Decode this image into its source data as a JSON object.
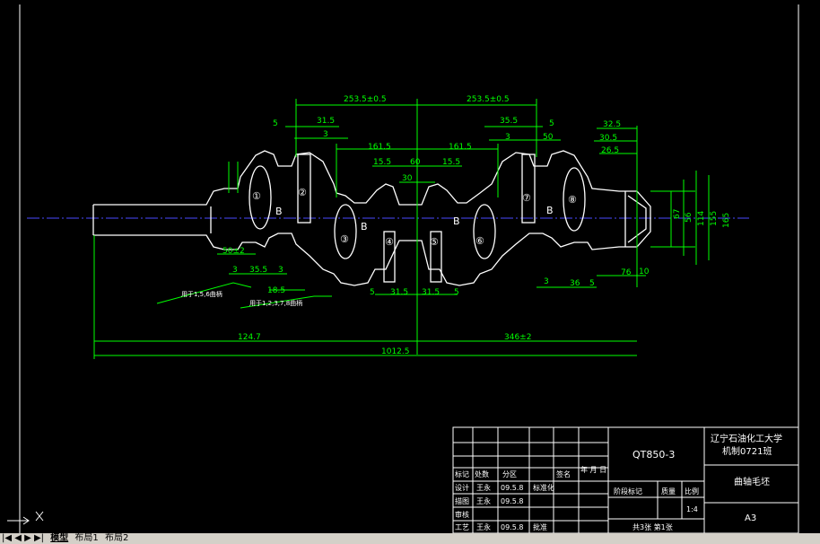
{
  "tabs": {
    "nav": "|◀ ◀ ▶ ▶|",
    "model": "模型",
    "layout1": "布局1",
    "layout2": "布局2"
  },
  "dimensions": {
    "d253_left": "253.5±0.5",
    "d253_right": "253.5±0.5",
    "d5_a": "5",
    "d315_a": "31.5",
    "d3_a": "3",
    "d1615_a": "161.5",
    "d1615_b": "161.5",
    "d155_a": "15.5",
    "d155_b": "15.5",
    "d60": "60",
    "d30": "30",
    "d355": "35.5",
    "d3_b": "3",
    "d5_b": "5",
    "d50": "50",
    "d325": "32.5",
    "d305": "30.5",
    "d265": "26.5",
    "d50pm": "50±2",
    "d3_c": "3",
    "d355_b": "35.5",
    "d3_d": "3",
    "d185": "18.5",
    "d315_b": "31.5",
    "d5_c": "5",
    "d315_c": "31.5",
    "d5_d": "5",
    "d3_e": "3",
    "d36": "36",
    "d5_e": "5",
    "d76": "76",
    "d10": "10",
    "d1247": "124.7",
    "d346": "346±2",
    "d1012": "1012.5",
    "v67": "67",
    "v56": "56",
    "v114": "114",
    "v155": "155",
    "v165": "165",
    "note1": "用于1,5,6曲柄",
    "note2": "用于1,2,3,7,8曲柄"
  },
  "journals": [
    "①",
    "B",
    "②",
    "③",
    "B",
    "④",
    "⑤",
    "B",
    "⑥",
    "⑦",
    "B",
    "⑧"
  ],
  "title_block": {
    "material": "QT850-3",
    "school": "辽宁石油化工大学",
    "class": "机制0721班",
    "part_name": "曲轴毛坯",
    "sheet_size": "A3",
    "sheets": "共3张  第1张",
    "scale": "1:4",
    "h_mark": "标记",
    "h_count": "处数",
    "h_zone": "分区",
    "h_sign": "签名",
    "h_date": "年 月 日",
    "r_design": "设计",
    "r_drafter": "描图",
    "r_review": "审核",
    "r_process": "工艺",
    "name1": "王永",
    "name2": "王永",
    "name3": "王永",
    "date1": "09.5.8",
    "date2": "09.5.8",
    "date3": "09.5.8",
    "standard": "标准化",
    "approve": "批准",
    "stage": "阶段标记",
    "mass": "质量",
    "ratio": "比例"
  },
  "colors": {
    "dim": "#00ff00",
    "outline": "#ffffff",
    "center": "#4040ff",
    "frame": "#ffffff"
  }
}
